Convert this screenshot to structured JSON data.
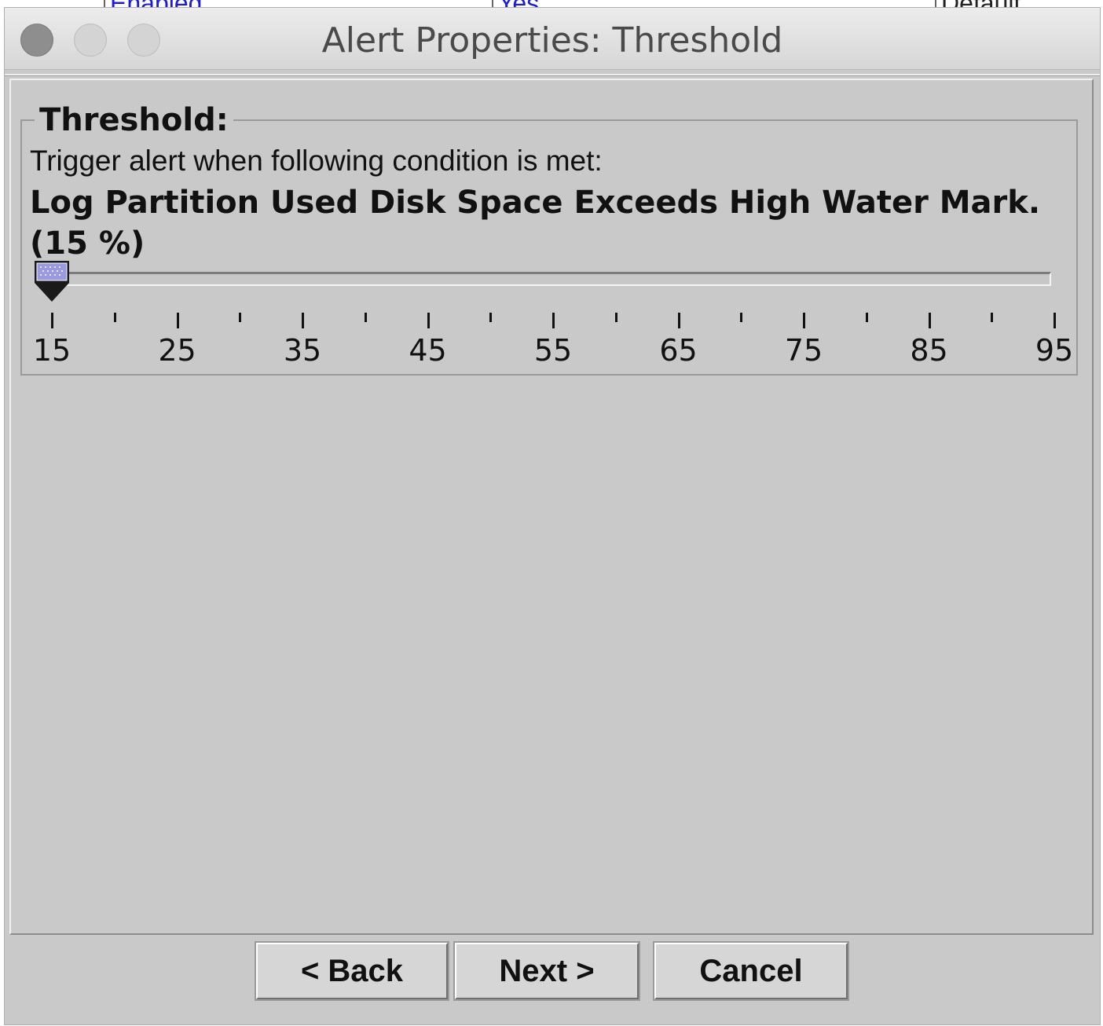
{
  "background_window": {
    "cells": [
      "Enabled",
      "Yes",
      "Default"
    ]
  },
  "window": {
    "title": "Alert Properties: Threshold",
    "controls": [
      "close",
      "minimize",
      "zoom"
    ]
  },
  "threshold": {
    "legend": "Threshold:",
    "description": "Trigger alert when following condition is met:",
    "condition": "Log Partition Used Disk Space Exceeds High Water Mark. (15 %)",
    "slider": {
      "min": 15,
      "max": 95,
      "value": 15,
      "major_tick_labels": [
        "15",
        "25",
        "35",
        "45",
        "55",
        "65",
        "75",
        "85",
        "95"
      ]
    }
  },
  "buttons": {
    "back": "< Back",
    "next": "Next >",
    "cancel": "Cancel"
  },
  "colors": {
    "dialog_bg": "#c9c9c9",
    "thumb_fill": "#9a9ae0",
    "link_text": "#1a1ae0"
  }
}
